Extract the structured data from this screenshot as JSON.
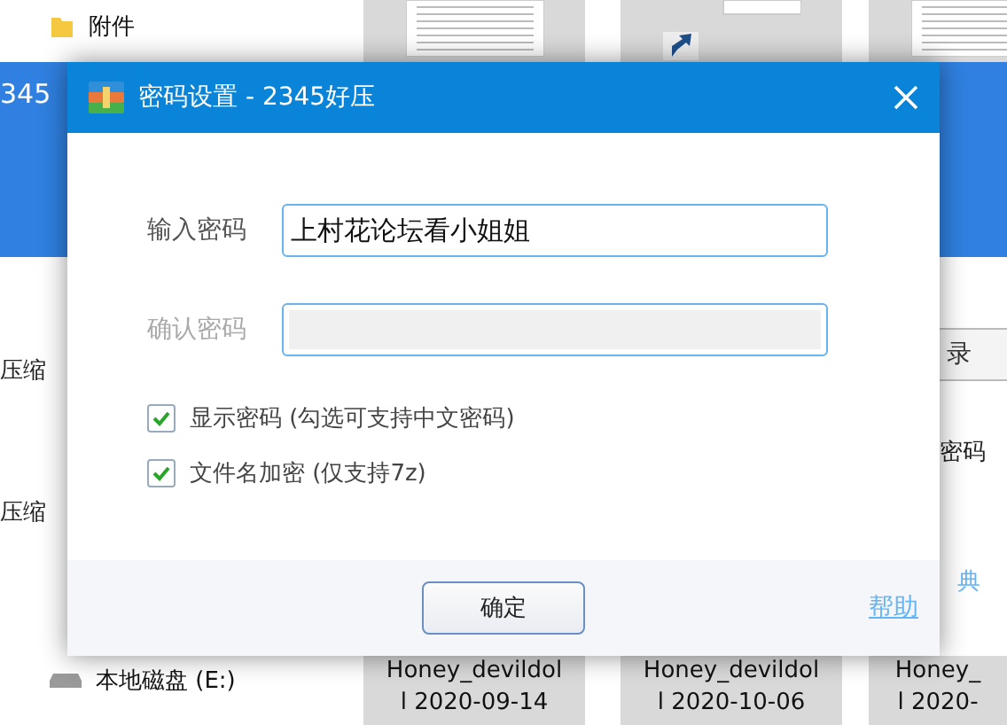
{
  "explorer": {
    "sidebar_items": [
      {
        "label": "附件",
        "kind": "folder"
      },
      {
        "label": "本地磁盘 (E:)",
        "kind": "drive"
      }
    ],
    "files": [
      {
        "line1": "Honey_devildol",
        "line2": "l 2020-09-14",
        "kind": "document"
      },
      {
        "line1": "Honey_devildol",
        "line2": "l 2020-10-06",
        "kind": "shortcut"
      },
      {
        "line1": "Honey_",
        "line2": "l 2020-",
        "kind": "document"
      }
    ]
  },
  "background_app": {
    "title": "345",
    "left_labels": [
      "压缩",
      "压缩"
    ],
    "right_button": "录",
    "right_label": "密码",
    "right_link": "典"
  },
  "dialog": {
    "title": "密码设置 - 2345好压",
    "fields": [
      {
        "label": "输入密码",
        "value": "上村花论坛看小姐姐",
        "disabled": false
      },
      {
        "label": "确认密码",
        "disabled": true
      }
    ],
    "checkboxes": [
      {
        "label": "显示密码 (勾选可支持中文密码)",
        "checked": true
      },
      {
        "label": "文件名加密 (仅支持7z)",
        "checked": true
      }
    ],
    "ok_button": "确定",
    "help_link": "帮助"
  }
}
